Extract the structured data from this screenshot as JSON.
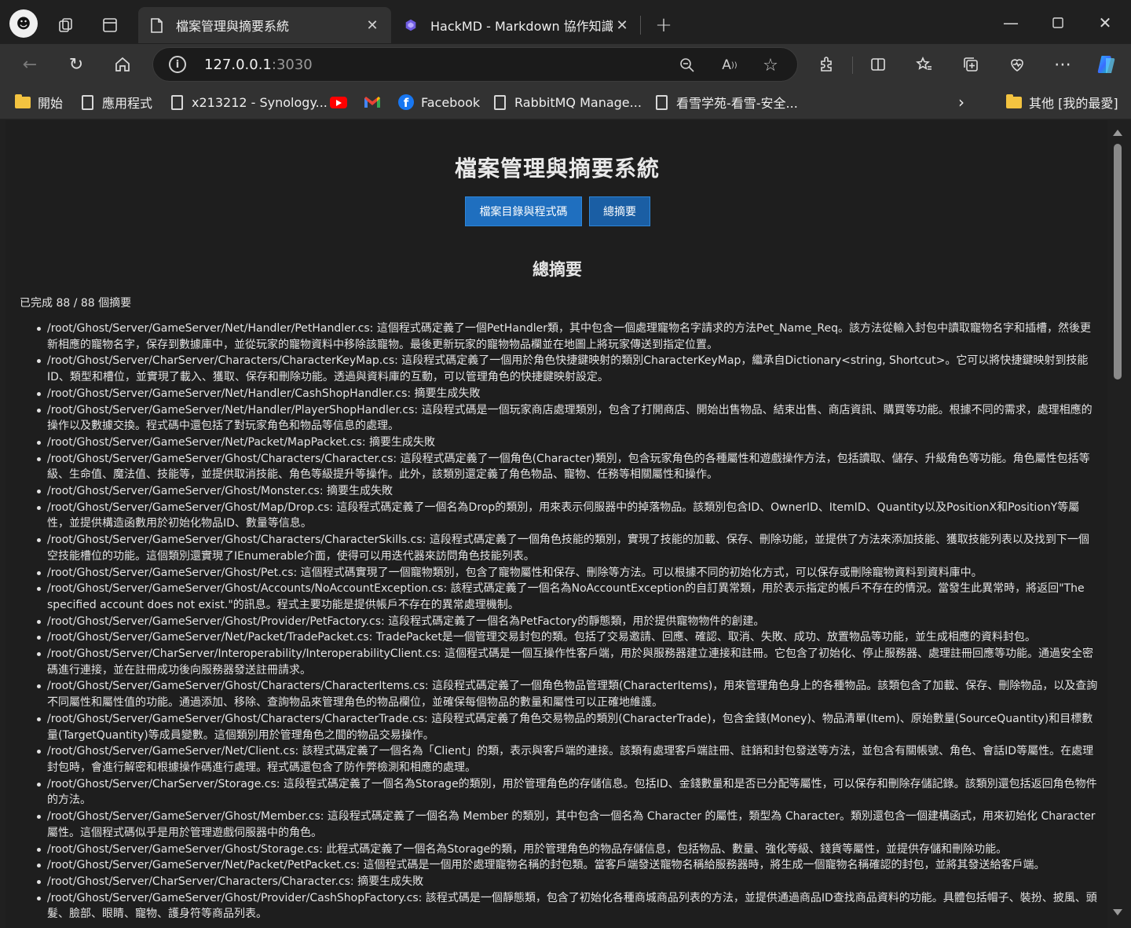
{
  "browser": {
    "tabs": [
      {
        "title": "檔案管理與摘要系統",
        "active": true
      },
      {
        "title": "HackMD - Markdown 協作知識庫",
        "active": false
      }
    ],
    "url_host": "127.0.0.1",
    "url_port": ":3030",
    "bookmarks": [
      {
        "label": "開始",
        "icon": "folder-icon"
      },
      {
        "label": "應用程式",
        "icon": "page-icon"
      },
      {
        "label": "x213212 - Synology...",
        "icon": "page-icon"
      },
      {
        "label": "",
        "icon": "youtube-icon"
      },
      {
        "label": "",
        "icon": "gmail-icon"
      },
      {
        "label": "Facebook",
        "icon": "facebook-icon"
      },
      {
        "label": "RabbitMQ Manage...",
        "icon": "page-icon"
      },
      {
        "label": "看雪学苑-看雪-安全...",
        "icon": "page-icon"
      }
    ],
    "other_favorites": "其他 [我的最愛]",
    "accent_blue": "#1f6fbf"
  },
  "page": {
    "title": "檔案管理與摘要系統",
    "nav": {
      "files_button": "檔案目錄與程式碼",
      "summary_button": "總摘要"
    },
    "section_title": "總摘要",
    "progress": "已完成 88 / 88 個摘要",
    "summaries": [
      "/root/Ghost/Server/GameServer/Net/Handler/PetHandler.cs: 這個程式碼定義了一個PetHandler類，其中包含一個處理寵物名字請求的方法Pet_Name_Req。該方法從輸入封包中讀取寵物名字和插槽，然後更新相應的寵物名字，保存到數據庫中，並從玩家的寵物資料中移除該寵物。最後更新玩家的寵物物品欄並在地圖上將玩家傳送到指定位置。",
      "/root/Ghost/Server/CharServer/Characters/CharacterKeyMap.cs: 這段程式碼定義了一個用於角色快捷鍵映射的類別CharacterKeyMap，繼承自Dictionary<string, Shortcut>。它可以將快捷鍵映射到技能ID、類型和槽位，並實現了載入、獲取、保存和刪除功能。透過與資料庫的互動，可以管理角色的快捷鍵映射設定。",
      "/root/Ghost/Server/GameServer/Net/Handler/CashShopHandler.cs: 摘要生成失敗",
      "/root/Ghost/Server/GameServer/Net/Handler/PlayerShopHandler.cs: 這段程式碼是一個玩家商店處理類別，包含了打開商店、開始出售物品、結束出售、商店資訊、購買等功能。根據不同的需求，處理相應的操作以及數據交換。程式碼中還包括了對玩家角色和物品等信息的處理。",
      "/root/Ghost/Server/GameServer/Net/Packet/MapPacket.cs: 摘要生成失敗",
      "/root/Ghost/Server/GameServer/Ghost/Characters/Character.cs: 這段程式碼定義了一個角色(Character)類別，包含玩家角色的各種屬性和遊戲操作方法，包括讀取、儲存、升級角色等功能。角色屬性包括等級、生命值、魔法值、技能等，並提供取消技能、角色等級提升等操作。此外，該類別還定義了角色物品、寵物、任務等相關屬性和操作。",
      "/root/Ghost/Server/GameServer/Ghost/Monster.cs: 摘要生成失敗",
      "/root/Ghost/Server/GameServer/Ghost/Map/Drop.cs: 這段程式碼定義了一個名為Drop的類別，用來表示伺服器中的掉落物品。該類別包含ID、OwnerID、ItemID、Quantity以及PositionX和PositionY等屬性，並提供構造函數用於初始化物品ID、數量等信息。",
      "/root/Ghost/Server/GameServer/Ghost/Characters/CharacterSkills.cs: 這段程式碼定義了一個角色技能的類別，實現了技能的加載、保存、刪除功能，並提供了方法來添加技能、獲取技能列表以及找到下一個空技能槽位的功能。這個類別還實現了IEnumerable介面，使得可以用迭代器來訪問角色技能列表。",
      "/root/Ghost/Server/GameServer/Ghost/Pet.cs: 這個程式碼實現了一個寵物類別，包含了寵物屬性和保存、刪除等方法。可以根據不同的初始化方式，可以保存或刪除寵物資料到資料庫中。",
      "/root/Ghost/Server/GameServer/Ghost/Accounts/NoAccountException.cs: 該程式碼定義了一個名為NoAccountException的自訂異常類，用於表示指定的帳戶不存在的情況。當發生此異常時，將返回\"The specified account does not exist.\"的訊息。程式主要功能是提供帳戶不存在的異常處理機制。",
      "/root/Ghost/Server/GameServer/Ghost/Provider/PetFactory.cs: 這段程式碼定義了一個名為PetFactory的靜態類，用於提供寵物物件的創建。",
      "/root/Ghost/Server/GameServer/Net/Packet/TradePacket.cs: TradePacket是一個管理交易封包的類。包括了交易邀請、回應、確認、取消、失敗、成功、放置物品等功能，並生成相應的資料封包。",
      "/root/Ghost/Server/CharServer/Interoperability/InteroperabilityClient.cs: 這個程式碼是一個互操作性客戶端，用於與服務器建立連接和註冊。它包含了初始化、停止服務器、處理註冊回應等功能。通過安全密碼進行連接，並在註冊成功後向服務器發送註冊請求。",
      "/root/Ghost/Server/GameServer/Ghost/Characters/CharacterItems.cs: 這段程式碼定義了一個角色物品管理類(CharacterItems)，用來管理角色身上的各種物品。該類包含了加載、保存、刪除物品，以及查詢不同屬性和屬性值的功能。通過添加、移除、查詢物品來管理角色的物品欄位，並確保每個物品的數量和屬性可以正確地維護。",
      "/root/Ghost/Server/GameServer/Ghost/Characters/CharacterTrade.cs: 這段程式碼定義了角色交易物品的類別(CharacterTrade)，包含金錢(Money)、物品清單(Item)、原始數量(SourceQuantity)和目標數量(TargetQuantity)等成員變數。這個類別用於管理角色之間的物品交易操作。",
      "/root/Ghost/Server/GameServer/Net/Client.cs: 該程式碼定義了一個名為「Client」的類，表示與客戶端的連接。該類有處理客戶端註冊、註銷和封包發送等方法，並包含有關帳號、角色、會話ID等屬性。在處理封包時，會進行解密和根據操作碼進行處理。程式碼還包含了防作弊檢測和相應的處理。",
      "/root/Ghost/Server/CharServer/Storage.cs: 這段程式碼定義了一個名為Storage的類別，用於管理角色的存儲信息。包括ID、金錢數量和是否已分配等屬性，可以保存和刪除存儲記錄。該類別還包括返回角色物件的方法。",
      "/root/Ghost/Server/GameServer/Ghost/Member.cs: 這段程式碼定義了一個名為 Member 的類別，其中包含一個名為 Character 的屬性，類型為 Character。類別還包含一個建構函式，用來初始化 Character 屬性。這個程式碼似乎是用於管理遊戲伺服器中的角色。",
      "/root/Ghost/Server/GameServer/Ghost/Storage.cs: 此程式碼定義了一個名為Storage的類，用於管理角色的物品存儲信息，包括物品、數量、強化等級、錢貨等屬性，並提供存儲和刪除功能。",
      "/root/Ghost/Server/GameServer/Net/Packet/PetPacket.cs: 這個程式碼是一個用於處理寵物名稱的封包類。當客戶端發送寵物名稱給服務器時，將生成一個寵物名稱確認的封包，並將其發送給客戶端。",
      "/root/Ghost/Server/CharServer/Characters/Character.cs: 摘要生成失敗",
      "/root/Ghost/Server/GameServer/Ghost/Provider/CashShopFactory.cs: 該程式碼是一個靜態類，包含了初始化各種商城商品列表的方法，並提供通過商品ID查找商品資料的功能。具體包括帽子、裝扮、披風、頭髮、臉部、眼睛、寵物、護身符等商品列表。"
    ]
  }
}
